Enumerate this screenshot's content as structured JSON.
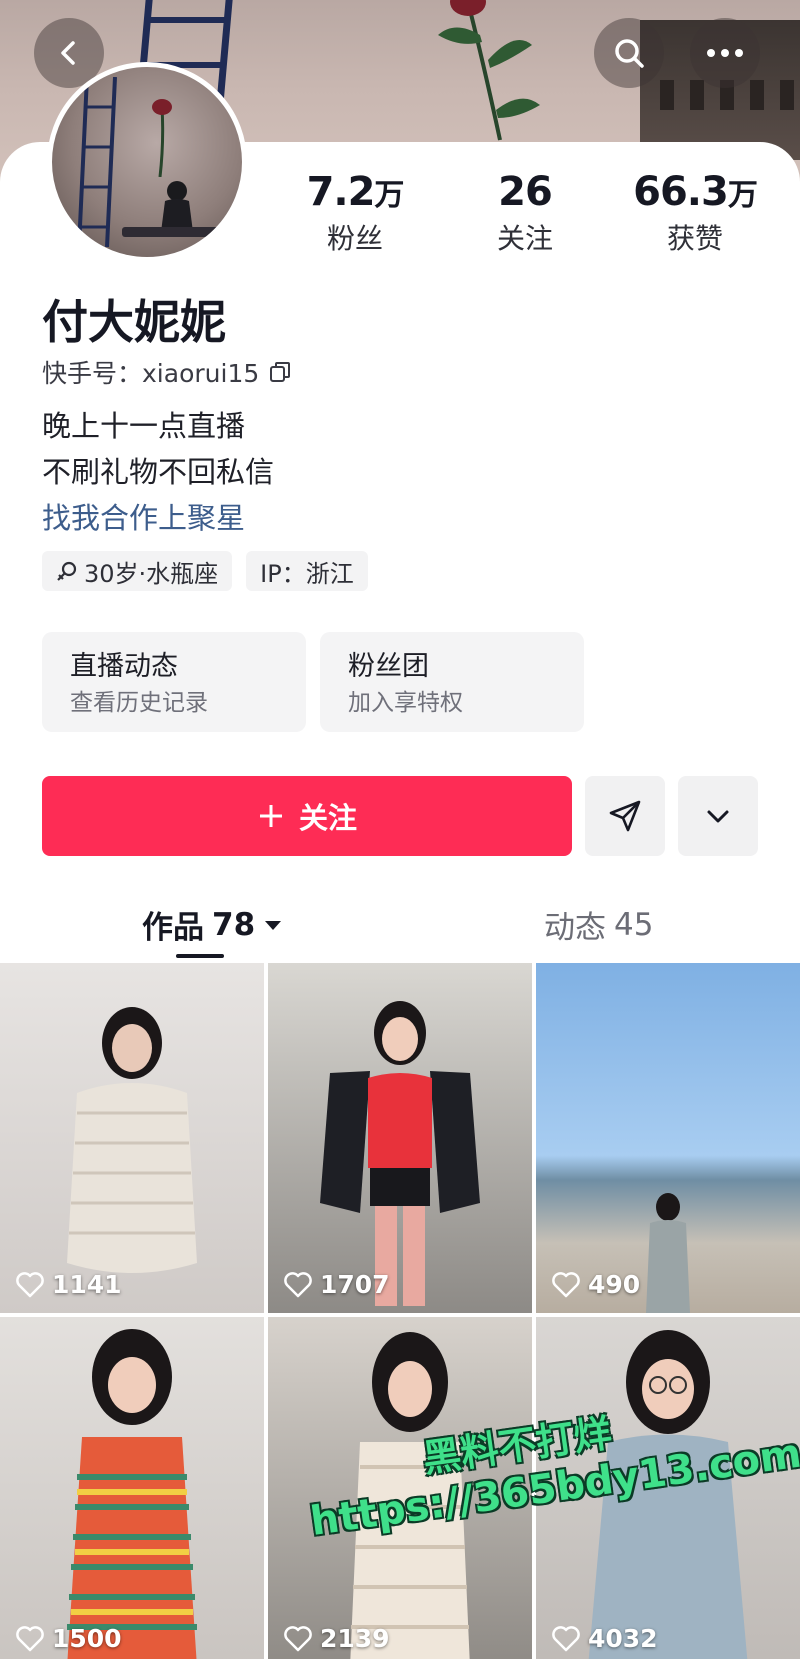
{
  "profile": {
    "name": "付大妮妮",
    "kuaishou_id_label": "快手号：",
    "kuaishou_id": "xiaorui15",
    "bio_lines": [
      "晚上十一点直播",
      "不刷礼物不回私信"
    ],
    "bio_link": "找我合作上聚星"
  },
  "stats": [
    {
      "num": "7.2",
      "unit": "万",
      "label": "粉丝"
    },
    {
      "num": "26",
      "unit": "",
      "label": "关注"
    },
    {
      "num": "66.3",
      "unit": "万",
      "label": "获赞"
    }
  ],
  "tags": [
    {
      "icon": "female-symbol-icon",
      "text": "30岁·水瓶座"
    },
    {
      "icon": "",
      "text": "IP：浙江"
    }
  ],
  "features": [
    {
      "title": "直播动态",
      "subtitle": "查看历史记录"
    },
    {
      "title": "粉丝团",
      "subtitle": "加入享特权"
    }
  ],
  "actions": {
    "follow_label": "关注",
    "follow_icon": "plus-icon",
    "message_icon": "send-arrow-icon",
    "more_icon": "chevron-down-icon"
  },
  "tabs": {
    "works_label": "作品",
    "works_count": "78",
    "moments_label": "动态",
    "moments_count": "45"
  },
  "videos": [
    {
      "likes": "1141"
    },
    {
      "likes": "1707"
    },
    {
      "likes": "490"
    },
    {
      "likes": "1500"
    },
    {
      "likes": "2139"
    },
    {
      "likes": "4032"
    }
  ],
  "watermark": {
    "line1": "黑料不打烊",
    "line2": "https://365bdy13.com"
  },
  "colors": {
    "accent": "#fe2c55",
    "link": "#3d5d8c",
    "watermark": "#3fe08a"
  }
}
